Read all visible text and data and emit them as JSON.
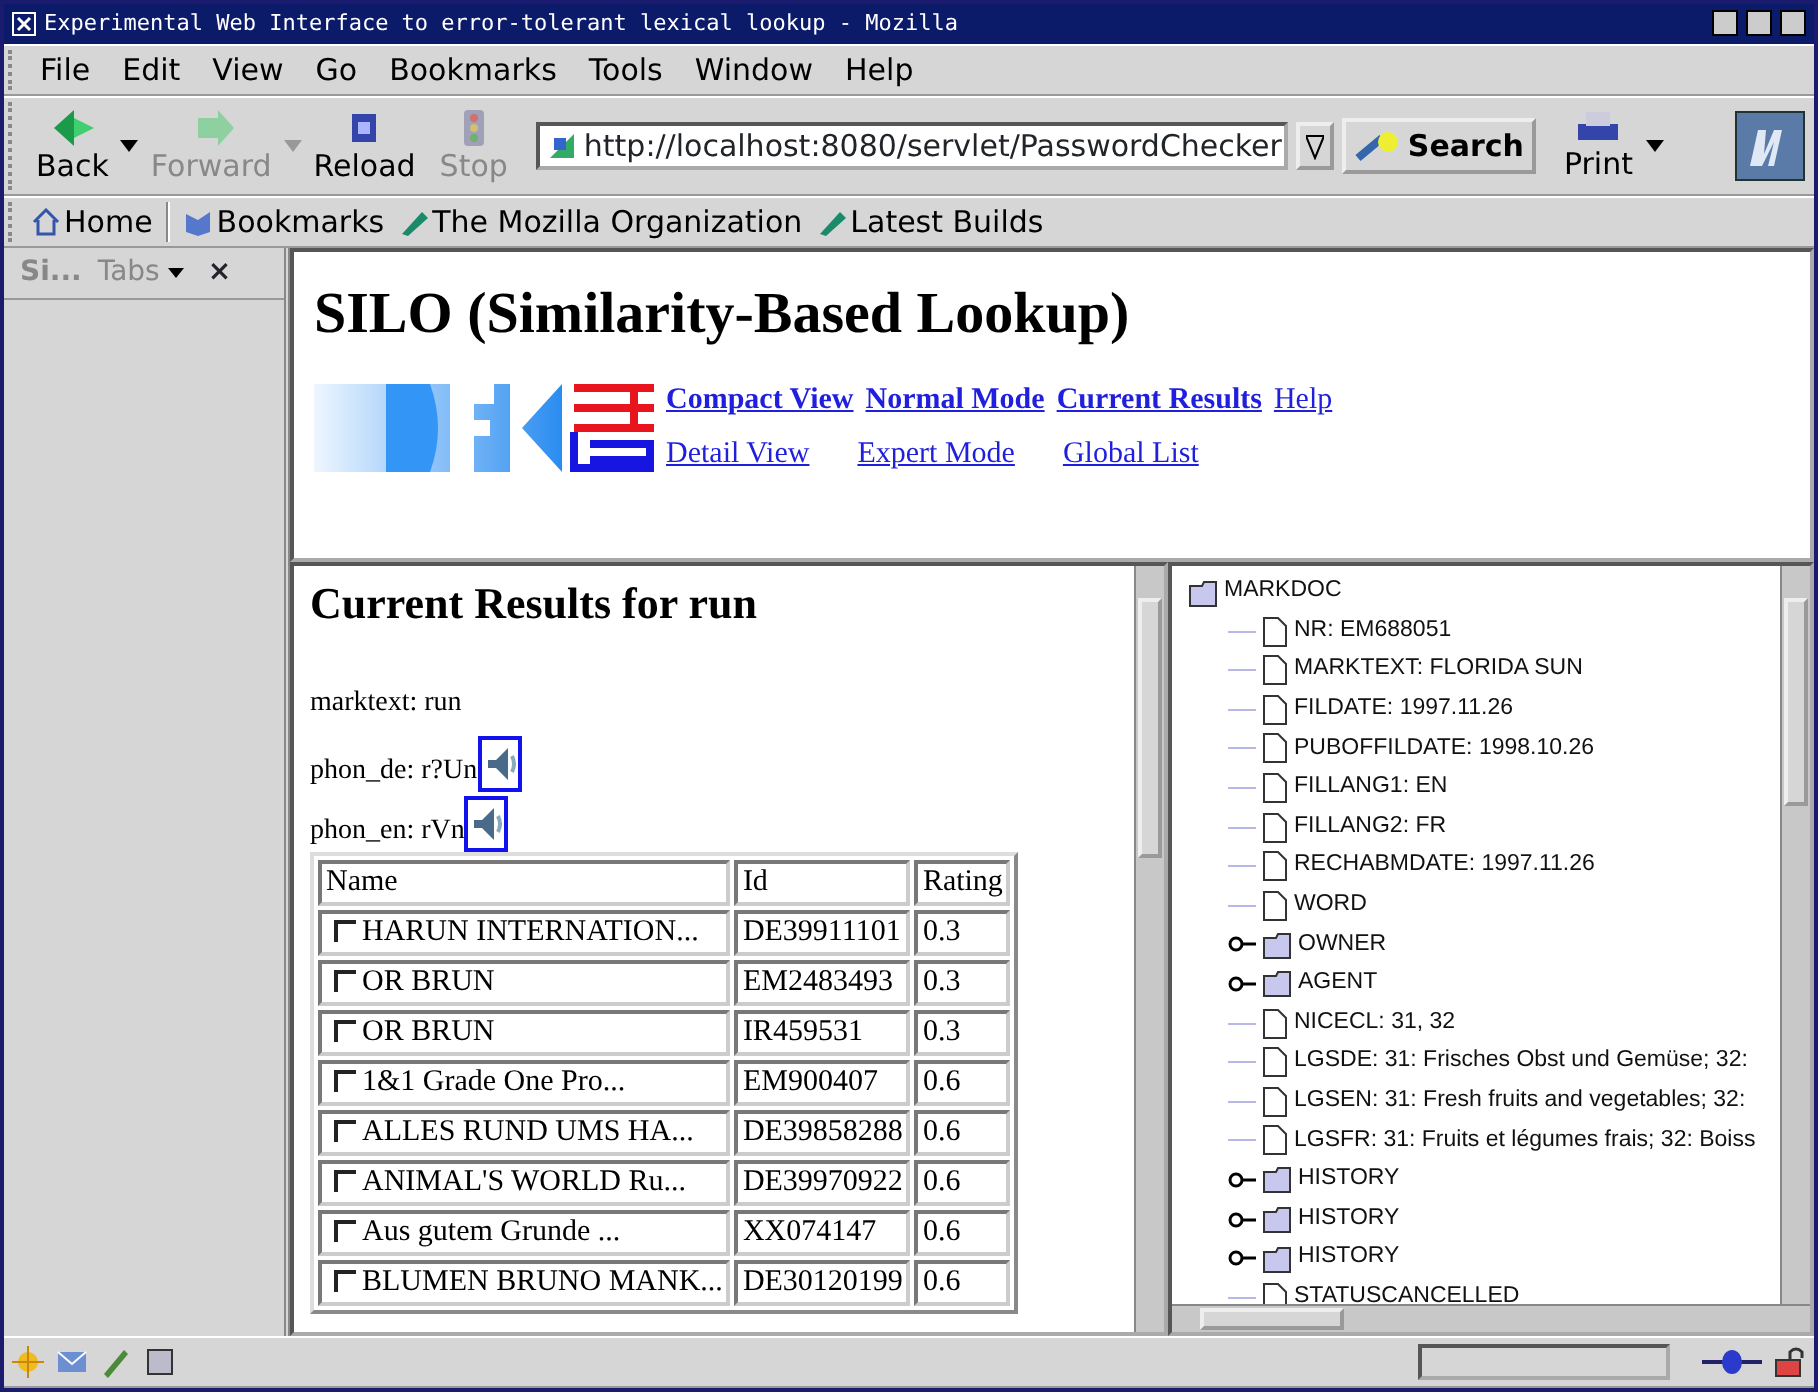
{
  "window": {
    "title": "Experimental Web Interface to error-tolerant lexical lookup - Mozilla"
  },
  "menu": [
    "File",
    "Edit",
    "View",
    "Go",
    "Bookmarks",
    "Tools",
    "Window",
    "Help"
  ],
  "nav_buttons": [
    {
      "label": "Back",
      "disabled": false,
      "dropdown": true,
      "kind": "back"
    },
    {
      "label": "Forward",
      "disabled": true,
      "dropdown": true,
      "kind": "forward"
    },
    {
      "label": "Reload",
      "disabled": false,
      "dropdown": false,
      "kind": "reload"
    },
    {
      "label": "Stop",
      "disabled": true,
      "dropdown": false,
      "kind": "stop"
    }
  ],
  "url": "http://localhost:8080/servlet/PasswordChecker",
  "search_button": "Search",
  "print_button": "Print",
  "personal_toolbar": [
    {
      "label": "Home",
      "kind": "home"
    },
    {
      "label": "Bookmarks",
      "kind": "bookmarks"
    },
    {
      "label": "The Mozilla Organization",
      "kind": "link"
    },
    {
      "label": "Latest Builds",
      "kind": "link"
    }
  ],
  "sidebar": {
    "title": "Si...",
    "tabs_menu": "Tabs",
    "close": "×"
  },
  "page": {
    "title": "SILO (Similarity-Based Lookup)",
    "links": [
      [
        {
          "label": "Compact View",
          "selected": true
        },
        {
          "label": "Normal Mode",
          "selected": true
        },
        {
          "label": "Current Results",
          "selected": true
        },
        {
          "label": "Help",
          "selected": false
        }
      ],
      [
        {
          "label": "Detail View",
          "selected": false
        },
        {
          "label": "Expert Mode",
          "selected": false
        },
        {
          "label": "Global List",
          "selected": false
        }
      ]
    ]
  },
  "results": {
    "title": "Current Results for run",
    "marktext": "marktext: run",
    "phon_de": "phon_de: r?Un",
    "phon_en": "phon_en: rVn",
    "columns": [
      "Name",
      "Id",
      "Rating"
    ],
    "rows": [
      {
        "name": "HARUN INTERNATION...",
        "id": "DE39911101",
        "rating": "0.3",
        "checked": false
      },
      {
        "name": "OR BRUN",
        "id": "EM2483493",
        "rating": "0.3",
        "checked": false
      },
      {
        "name": "OR BRUN",
        "id": "IR459531",
        "rating": "0.3",
        "checked": false
      },
      {
        "name": "1&1 Grade One Pro...",
        "id": "EM900407",
        "rating": "0.6",
        "checked": false
      },
      {
        "name": "ALLES RUND UMS HA...",
        "id": "DE39858288",
        "rating": "0.6",
        "checked": false
      },
      {
        "name": "ANIMAL'S WORLD Ru...",
        "id": "DE39970922",
        "rating": "0.6",
        "checked": false
      },
      {
        "name": "Aus gutem Grunde ...",
        "id": "XX074147",
        "rating": "0.6",
        "checked": false
      },
      {
        "name": "BLUMEN BRUNO MANK...",
        "id": "DE30120199",
        "rating": "0.6",
        "checked": false
      }
    ]
  },
  "tree": [
    {
      "label": "MARKDOC",
      "kind": "folder",
      "expanded": true,
      "children": [
        {
          "label": "NR: EM688051",
          "kind": "leaf"
        },
        {
          "label": "MARKTEXT: FLORIDA SUN",
          "kind": "leaf"
        },
        {
          "label": "FILDATE: 1997.11.26",
          "kind": "leaf"
        },
        {
          "label": "PUBOFFILDATE: 1998.10.26",
          "kind": "leaf"
        },
        {
          "label": "FILLANG1: EN",
          "kind": "leaf"
        },
        {
          "label": "FILLANG2: FR",
          "kind": "leaf"
        },
        {
          "label": "RECHABMDATE: 1997.11.26",
          "kind": "leaf"
        },
        {
          "label": "WORD",
          "kind": "leaf"
        },
        {
          "label": "OWNER",
          "kind": "folder",
          "expanded": false
        },
        {
          "label": "AGENT",
          "kind": "folder",
          "expanded": false
        },
        {
          "label": "NICECL: 31, 32",
          "kind": "leaf"
        },
        {
          "label": "LGSDE: 31: Frisches Obst und Gemüse; 32:",
          "kind": "leaf"
        },
        {
          "label": "LGSEN: 31: Fresh fruits and vegetables; 32:",
          "kind": "leaf"
        },
        {
          "label": "LGSFR: 31: Fruits et légumes frais; 32: Boiss",
          "kind": "leaf"
        },
        {
          "label": "HISTORY",
          "kind": "folder",
          "expanded": false
        },
        {
          "label": "HISTORY",
          "kind": "folder",
          "expanded": false
        },
        {
          "label": "HISTORY",
          "kind": "folder",
          "expanded": false
        },
        {
          "label": "STATUSCANCELLED",
          "kind": "leaf"
        }
      ]
    }
  ]
}
